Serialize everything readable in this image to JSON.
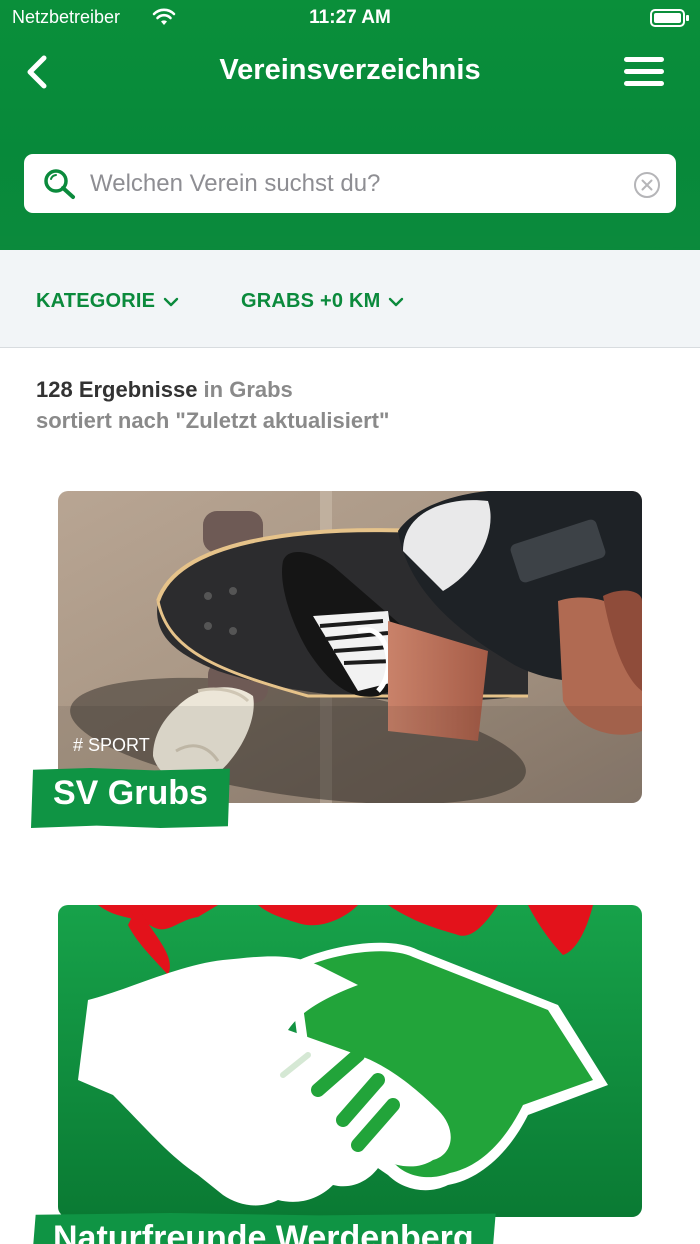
{
  "status_bar": {
    "carrier": "Netzbetreiber",
    "time": "11:27 AM"
  },
  "nav": {
    "title": "Vereinsverzeichnis",
    "back_icon": "chevron-left-icon",
    "menu_icon": "hamburger-menu-icon"
  },
  "search": {
    "placeholder": "Welchen Verein suchst du?",
    "value": ""
  },
  "filters": {
    "category_label": "KATEGORIE",
    "location_label": "GRABS +0 KM"
  },
  "results": {
    "count_text": "128 Ergebnisse",
    "location_text": " in Grabs",
    "sort_text": "sortiert nach \"Zuletzt aktualisiert\""
  },
  "clubs": [
    {
      "tag": "# SPORT",
      "name": "SV Grubs"
    },
    {
      "tag": "",
      "name": "Naturfreunde Werdenberg"
    }
  ],
  "colors": {
    "brand_green": "#0b8a3c",
    "title_green": "#0f9444",
    "filter_bg": "#f2f5f7"
  }
}
